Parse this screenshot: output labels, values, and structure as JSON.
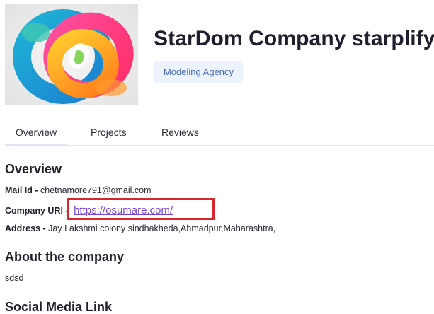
{
  "company": {
    "name": "StarDom Company starplify",
    "category": "Modeling Agency"
  },
  "tabs": [
    {
      "label": "Overview"
    },
    {
      "label": "Projects"
    },
    {
      "label": "Reviews"
    }
  ],
  "overview": {
    "heading": "Overview",
    "mail_label": "Mail Id -",
    "mail_value": "chetnamore791@gmail.com",
    "url_label": "Company URl -",
    "url_value": "https://osumare.com/",
    "address_label": "Address -",
    "address_value": "Jay Lakshmi colony sindhakheda,Ahmadpur,Maharashtra,"
  },
  "about": {
    "heading": "About the company",
    "text": "sdsd"
  },
  "social": {
    "heading": "Social Media Link"
  },
  "colors": {
    "accent": "#7b45d6",
    "badge_bg": "#edf3fc",
    "highlight": "#d8262d"
  }
}
